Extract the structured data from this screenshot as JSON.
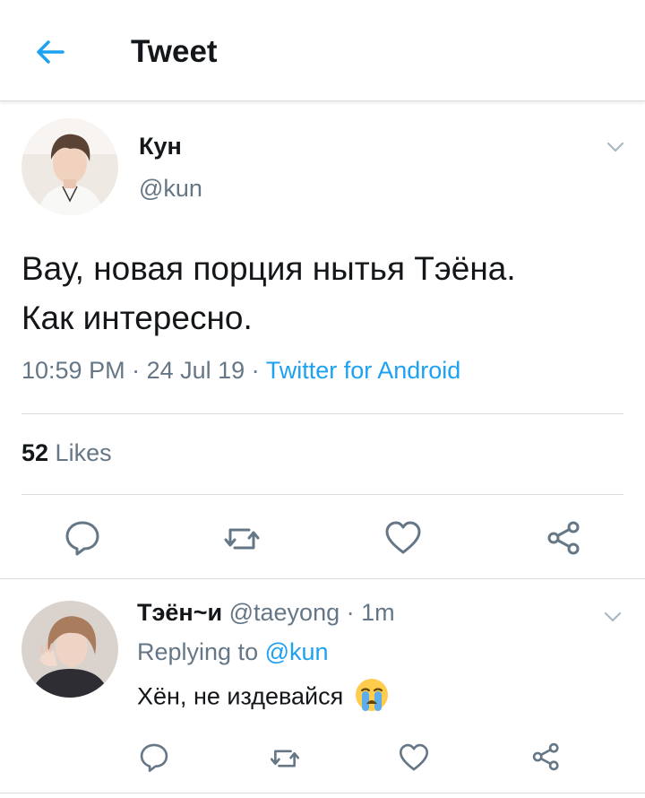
{
  "header": {
    "title": "Tweet",
    "back_icon": "arrow-left-icon",
    "accent": "#1da1f2"
  },
  "tweet": {
    "author_name": "Кун",
    "author_handle": "@kun",
    "text_line1": "Вау, новая порция нытья Тэёна.",
    "text_line2": "Как интересно.",
    "time": "10:59 PM",
    "sep1": " · ",
    "date": "24 Jul 19",
    "sep2": " · ",
    "source": "Twitter for Android",
    "likes_count": "52",
    "likes_label": " Likes"
  },
  "reply": {
    "author_name": "Тэён~и",
    "author_handle": "@taeyong",
    "sep": " · ",
    "age": "1m",
    "replying_prefix": "Replying to ",
    "replying_to": "@kun",
    "text": "Хён, не издевайся",
    "emoji_icon": "loudly-crying-face-icon"
  },
  "colors": {
    "text": "#14171a",
    "secondary": "#657786",
    "link": "#1da1f2",
    "divider": "#d8dde1"
  }
}
